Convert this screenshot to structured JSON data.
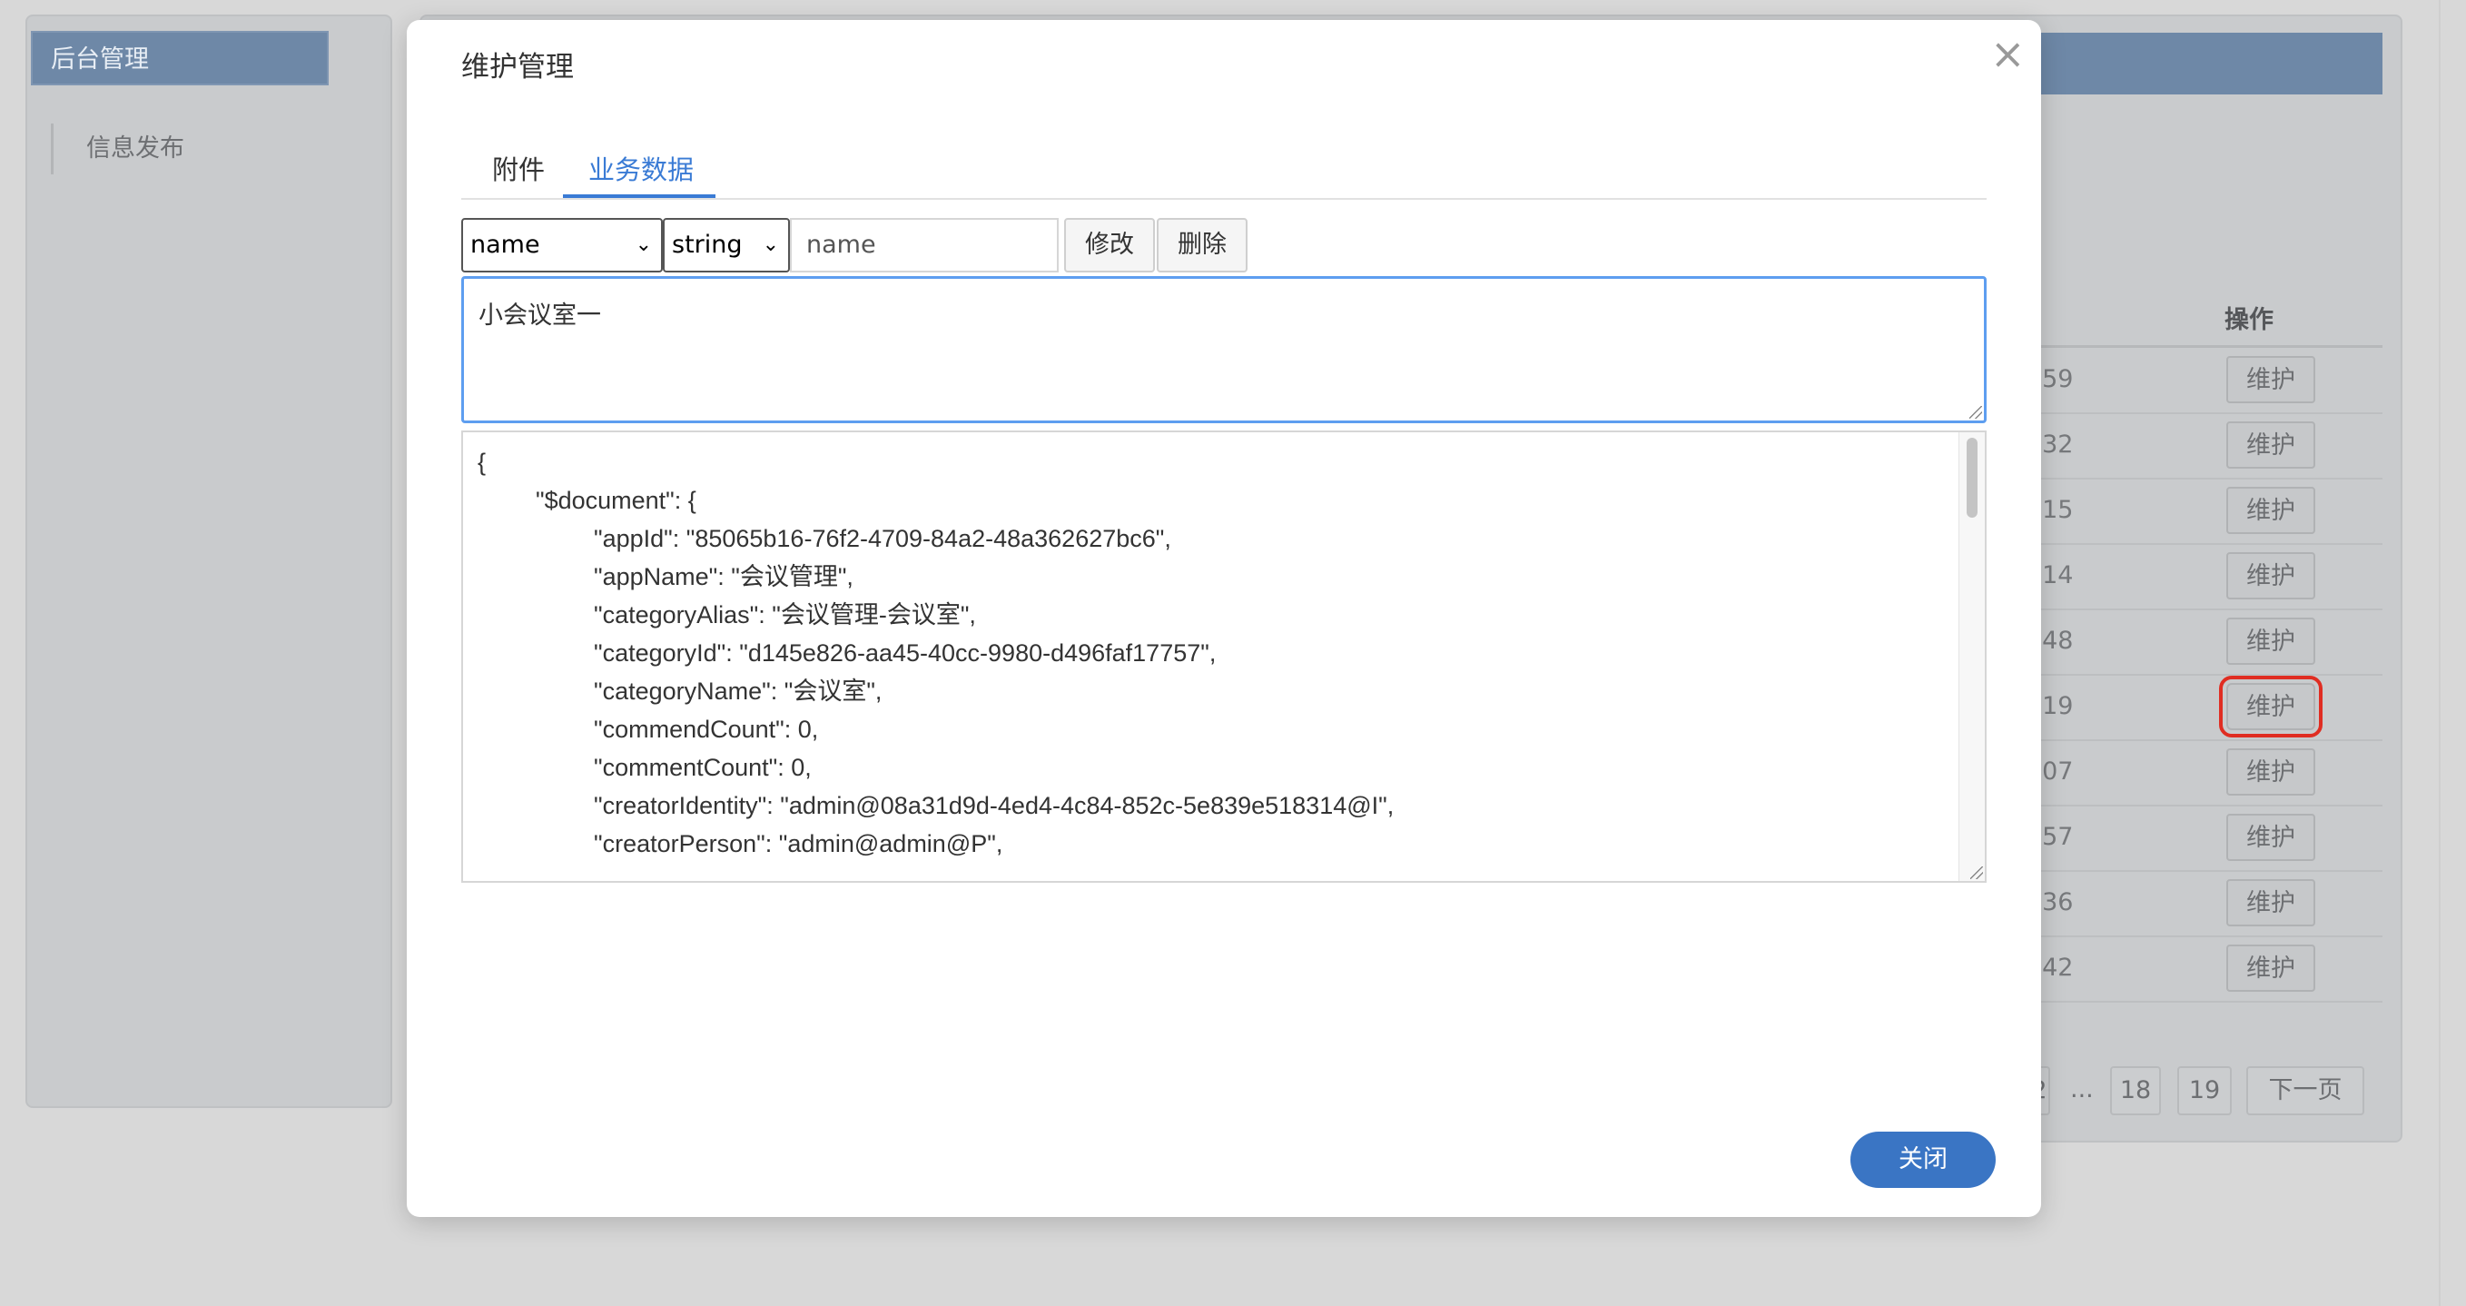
{
  "background": {
    "sidebar": {
      "header": "后台管理",
      "items": [
        "信息发布"
      ]
    },
    "table": {
      "action_header": "操作",
      "rows": [
        {
          "time": ":59",
          "action": "维护"
        },
        {
          "time": ":32",
          "action": "维护"
        },
        {
          "time": ":15",
          "action": "维护"
        },
        {
          "time": ":14",
          "action": "维护"
        },
        {
          "time": ":48",
          "action": "维护"
        },
        {
          "time": ":19",
          "action": "维护"
        },
        {
          "time": ":07",
          "action": "维护"
        },
        {
          "time": ":57",
          "action": "维护"
        },
        {
          "time": ":36",
          "action": "维护"
        },
        {
          "time": ":42",
          "action": "维护"
        }
      ]
    },
    "pagination": {
      "partial": "2",
      "ellipsis": "...",
      "page_18": "18",
      "page_19": "19",
      "next": "下一页"
    }
  },
  "modal": {
    "title": "维护管理",
    "close_icon": "×",
    "tabs": [
      {
        "label": "附件",
        "active": false
      },
      {
        "label": "业务数据",
        "active": true
      }
    ],
    "editor": {
      "field_select": "name",
      "type_select": "string",
      "field_input_value": "name",
      "modify_button": "修改",
      "delete_button": "删除",
      "value_text": "小会议室一"
    },
    "json_lines": [
      "{",
      "\t\"$document\": {",
      "\t\t\"appId\": \"85065b16-76f2-4709-84a2-48a362627bc6\",",
      "\t\t\"appName\": \"会议管理\",",
      "\t\t\"categoryAlias\": \"会议管理-会议室\",",
      "\t\t\"categoryId\": \"d145e826-aa45-40cc-9980-d496faf17757\",",
      "\t\t\"categoryName\": \"会议室\",",
      "\t\t\"commendCount\": 0,",
      "\t\t\"commentCount\": 0,",
      "\t\t\"creatorIdentity\": \"admin@08a31d9d-4ed4-4c84-852c-5e839e518314@I\",",
      "\t\t\"creatorPerson\": \"admin@admin@P\","
    ],
    "close_button": "关闭"
  },
  "colors": {
    "accent": "#3a7bd5",
    "primary_button": "#3a75c4",
    "highlight_outline": "#e02d22",
    "overlay_header": "#6e88a7"
  }
}
